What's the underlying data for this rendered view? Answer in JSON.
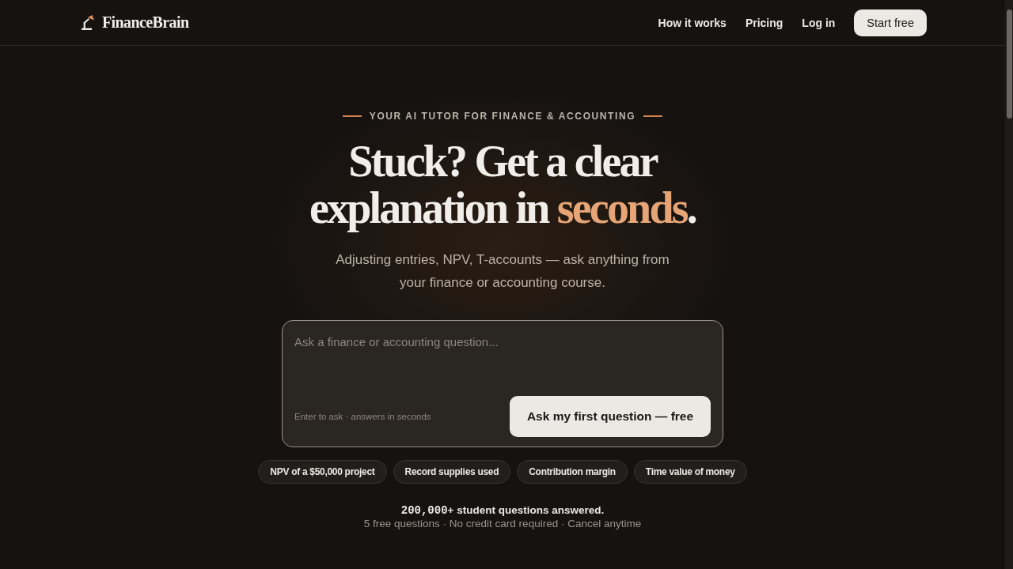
{
  "header": {
    "logo": "FinanceBrain",
    "nav": [
      "How it works",
      "Pricing",
      "Log in"
    ],
    "cta": "Start free"
  },
  "hero": {
    "eyebrow": "YOUR AI TUTOR FOR FINANCE & ACCOUNTING",
    "headline": {
      "text": "Stuck? Get a clear explanation in ",
      "highlight": "seconds",
      "end": "."
    },
    "subtitle": "Adjusting entries, NPV, T-accounts — ask anything from your finance or accounting course.",
    "ask_box": {
      "placeholder": "Ask a finance or accounting question...",
      "hint": "Enter to ask · answers in seconds",
      "button": "Ask my first question — free"
    },
    "suggestions": [
      "NPV of a $50,000 project",
      "Record supplies used",
      "Contribution margin",
      "Time value of money"
    ],
    "stats": {
      "count": "200,000",
      "rest": "+ student questions answered."
    },
    "fine_print": "5 free questions · No credit card required · Cancel anytime"
  }
}
